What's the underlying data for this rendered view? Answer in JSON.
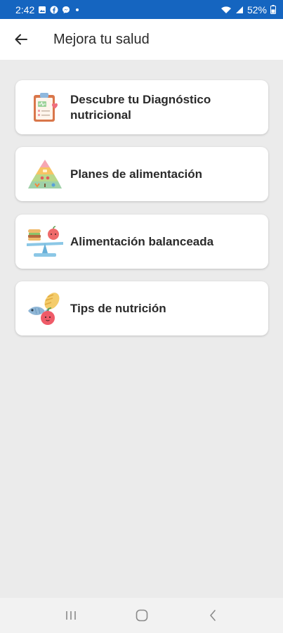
{
  "status_bar": {
    "time": "2:42",
    "battery": "52%",
    "icons": [
      "gallery-icon",
      "facebook-icon",
      "messenger-icon",
      "notification-dot-icon",
      "wifi-icon",
      "signal-icon",
      "battery-icon"
    ]
  },
  "app_bar": {
    "back_icon": "arrow-left-icon",
    "title": "Mejora tu salud"
  },
  "menu": {
    "items": [
      {
        "label": "Descubre tu Diagnóstico nutricional",
        "icon": "clipboard-diagnosis-icon"
      },
      {
        "label": "Planes de alimentación",
        "icon": "food-pyramid-icon"
      },
      {
        "label": "Alimentación balanceada",
        "icon": "balance-scale-food-icon"
      },
      {
        "label": "Tips de nutrición",
        "icon": "fish-bread-apple-icon"
      }
    ]
  },
  "nav_bar": {
    "icons": [
      "recent-apps-icon",
      "home-icon",
      "back-icon"
    ]
  },
  "colors": {
    "status_bar": "#1565c0",
    "background": "#ebebeb",
    "card": "#ffffff",
    "text": "#2a2a2a"
  }
}
